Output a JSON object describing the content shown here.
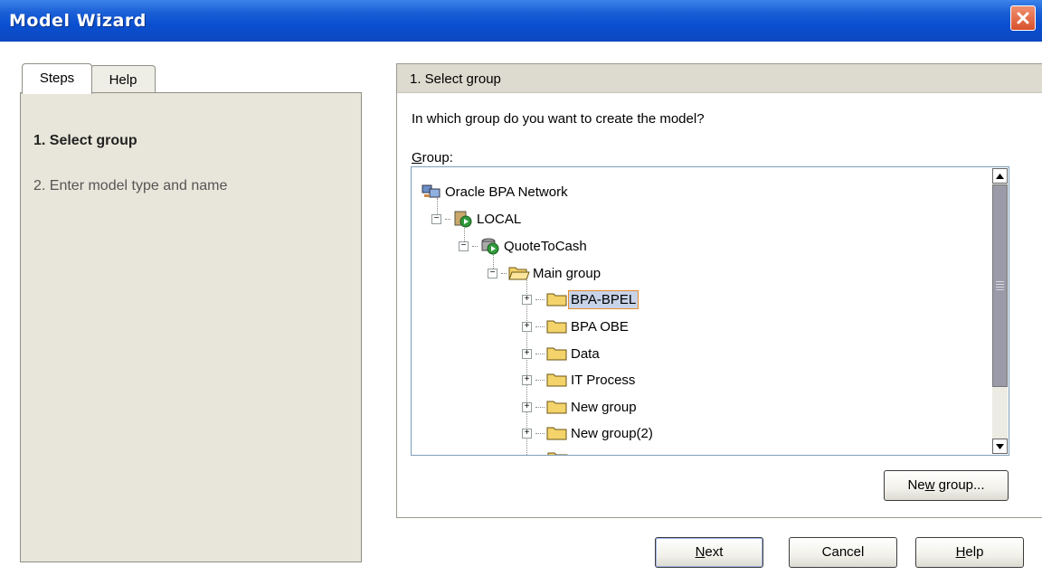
{
  "window": {
    "title": "Model Wizard"
  },
  "tabs": [
    {
      "label": "Steps"
    },
    {
      "label": "Help"
    }
  ],
  "steps": [
    {
      "label": "1. Select group"
    },
    {
      "label": "2. Enter model type and name"
    }
  ],
  "main": {
    "header": "1. Select group",
    "question": "In which group do you want to create the model?",
    "group_label": "Group:"
  },
  "tree": {
    "nodes": [
      {
        "label": "Oracle BPA Network",
        "icon": "network-icon"
      },
      {
        "label": "LOCAL",
        "icon": "server-icon",
        "expanded": true
      },
      {
        "label": "QuoteToCash",
        "icon": "database-icon",
        "expanded": true
      },
      {
        "label": "Main group",
        "icon": "open-folder-icon",
        "expanded": true
      },
      {
        "label": "BPA-BPEL",
        "icon": "folder-icon",
        "selected": true
      },
      {
        "label": "BPA OBE",
        "icon": "folder-icon"
      },
      {
        "label": "Data",
        "icon": "folder-icon"
      },
      {
        "label": "IT Process",
        "icon": "folder-icon"
      },
      {
        "label": "New group",
        "icon": "folder-icon"
      },
      {
        "label": "New group(2)",
        "icon": "folder-icon"
      }
    ]
  },
  "buttons": {
    "new_group": "New group...",
    "next": "Next",
    "cancel": "Cancel",
    "help": "Help"
  },
  "colors": {
    "titlebar": "#0a4fd0",
    "selection_border": "#e68b2c",
    "panel_bg": "#e8e6da"
  }
}
